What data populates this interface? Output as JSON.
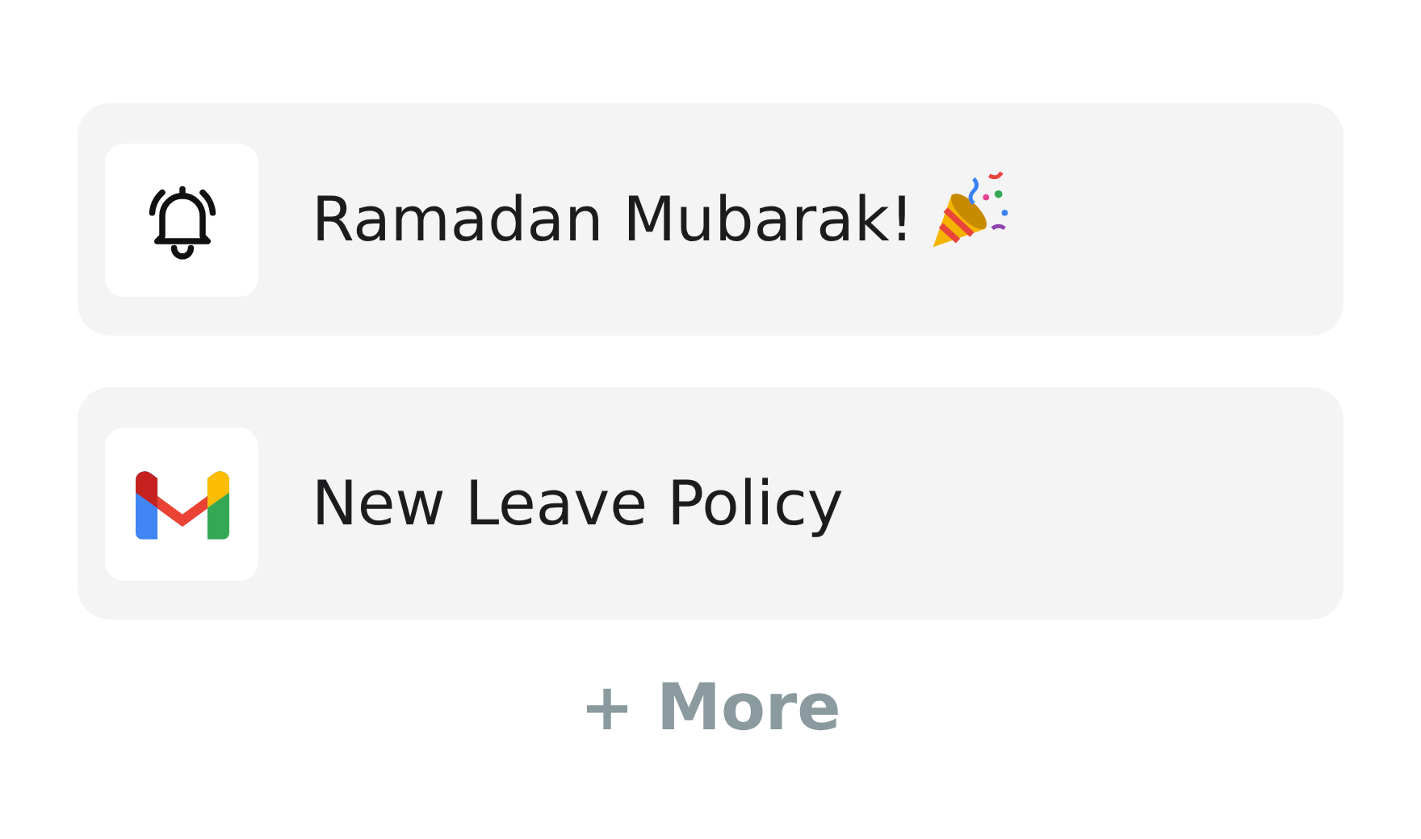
{
  "notifications": [
    {
      "kind": "greeting",
      "title": "Ramadan Mubarak!"
    },
    {
      "kind": "email",
      "title": "New Leave Policy"
    }
  ],
  "more_link": "+ More"
}
